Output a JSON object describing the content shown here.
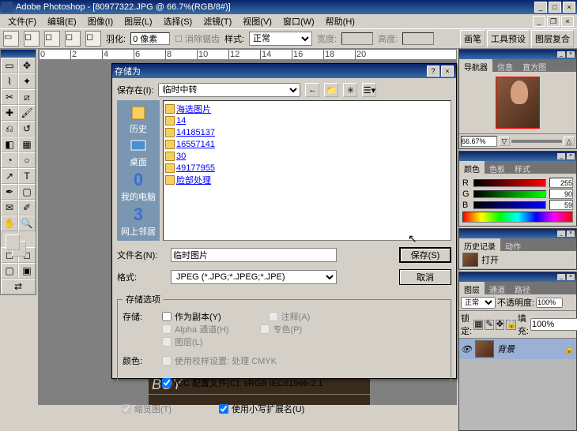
{
  "app": {
    "title": "Adobe Photoshop - [80977322.JPG @ 66.7%(RGB/8#)]"
  },
  "menu": {
    "file": "文件(F)",
    "edit": "编辑(E)",
    "image": "图像(I)",
    "layer": "图层(L)",
    "select": "选择(S)",
    "filter": "滤镜(T)",
    "view": "视图(V)",
    "window": "窗口(W)",
    "help": "帮助(H)"
  },
  "opt": {
    "feather_lbl": "羽化:",
    "feather_val": "0 像素",
    "antialias": "消除锯齿",
    "style_lbl": "样式:",
    "style_val": "正常",
    "width_lbl": "宽度:",
    "height_lbl": "高度:",
    "brush": "画笔",
    "toolpreset": "工具预设",
    "layercomp": "图层复合"
  },
  "ruler": [
    "0",
    "2",
    "4",
    "6",
    "8",
    "10",
    "12",
    "14",
    "16",
    "18",
    "20"
  ],
  "dialog": {
    "title": "存储为",
    "savein_lbl": "保存在(I):",
    "savein_val": "临时中转",
    "files": [
      "海选图片",
      "14",
      "14185137",
      "16557141",
      "30",
      "49177955",
      "脸部处理"
    ],
    "places": {
      "history": "历史",
      "desktop": "桌面",
      "mycomp": "我的电脑",
      "network": "网上邻居"
    },
    "filename_lbl": "文件名(N):",
    "filename_val": "临时图片",
    "format_lbl": "格式:",
    "format_val": "JPEG (*.JPG;*.JPEG;*.JPE)",
    "save_btn": "保存(S)",
    "cancel_btn": "取消",
    "storeopts": "存储选项",
    "store": "存储:",
    "color": "颜色:",
    "ascopy": "作为副本(Y)",
    "annot": "注释(A)",
    "alpha": "Alpha 通道(H)",
    "spot": "专色(P)",
    "layers": "图层(L)",
    "proof": "使用校样设置: 处理 CMYK",
    "icc": "ICC 配置文件(C): sRGB IEC61966-2.1",
    "thumb": "缩览图(T)",
    "lcext": "使用小写扩展名(U)"
  },
  "panels": {
    "nav": {
      "t1": "导航器",
      "t2": "信息",
      "t3": "直方图",
      "zoom": "66.67%"
    },
    "color": {
      "t1": "颜色",
      "t2": "色板",
      "t3": "样式",
      "r": "255",
      "g": "90",
      "b": "59"
    },
    "history": {
      "t1": "历史记录",
      "t2": "动作",
      "item": "打开"
    },
    "layers": {
      "t1": "图层",
      "t2": "通道",
      "t3": "路径",
      "mode": "正常",
      "opacity_lbl": "不透明度:",
      "opacity": "100%",
      "lock": "锁定:",
      "fill_lbl": "填充:",
      "fill": "100%",
      "bg": "背景"
    }
  }
}
